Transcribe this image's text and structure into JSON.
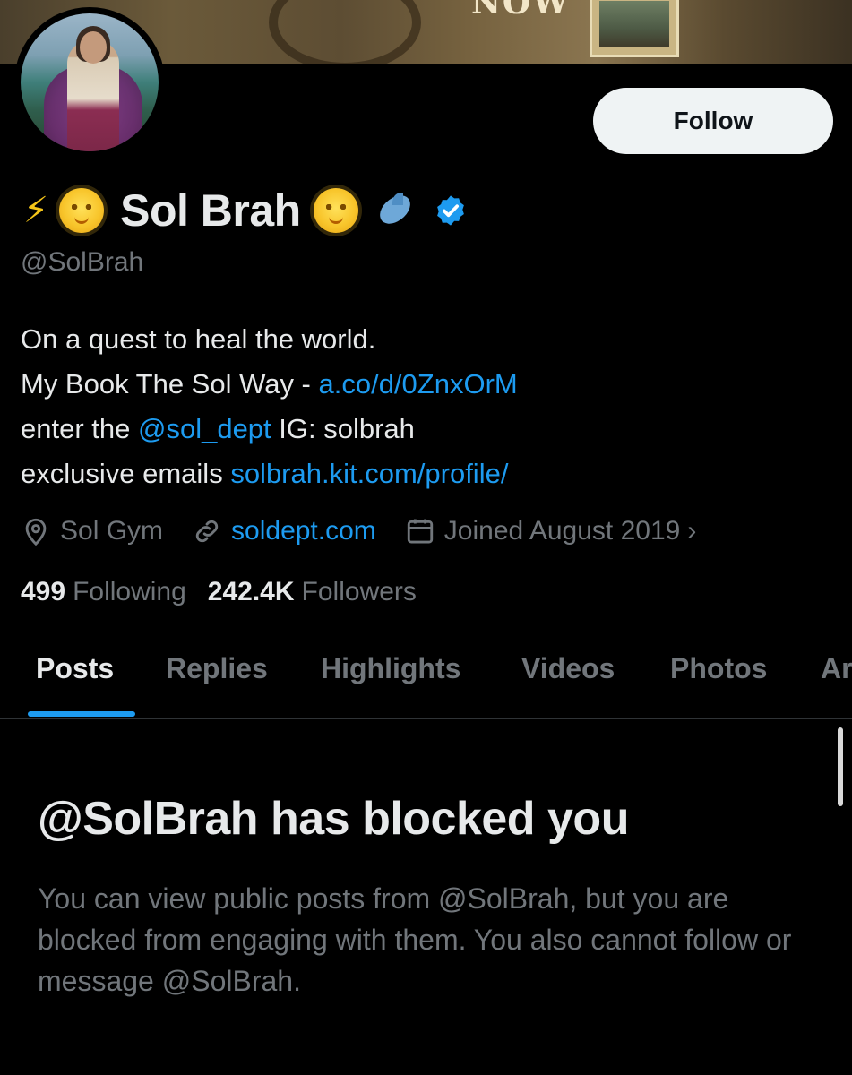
{
  "banner": {
    "text": "NOW"
  },
  "profile": {
    "name": "Sol Brah",
    "handle": "@SolBrah",
    "follow_label": "Follow"
  },
  "bio": {
    "line1": "On a quest to heal the world.",
    "line2_prefix": "My Book The Sol Way - ",
    "line2_link": "a.co/d/0ZnxOrM",
    "line3_prefix": "enter the ",
    "line3_mention": "@sol_dept",
    "line3_suffix": " IG: solbrah",
    "line4_prefix": "exclusive emails ",
    "line4_link": "solbrah.kit.com/profile/"
  },
  "meta": {
    "location": "Sol Gym",
    "website": "soldept.com",
    "joined": "Joined August 2019",
    "location_icon": "location-pin-icon",
    "link_icon": "link-icon",
    "calendar_icon": "calendar-icon",
    "chevron_icon": "chevron-right-icon"
  },
  "stats": {
    "following_count": "499",
    "following_label": "Following",
    "followers_count": "242.4K",
    "followers_label": "Followers"
  },
  "tabs": [
    {
      "label": "Posts",
      "active": true
    },
    {
      "label": "Replies",
      "active": false
    },
    {
      "label": "Highlights",
      "active": false
    },
    {
      "label": "Videos",
      "active": false
    },
    {
      "label": "Photos",
      "active": false
    },
    {
      "label": "Ar",
      "active": false
    }
  ],
  "blocked": {
    "title": "@SolBrah has blocked you",
    "description": "You can view public posts from @SolBrah, but you are blocked from engaging with them. You also cannot follow or message @SolBrah."
  },
  "colors": {
    "background": "#000000",
    "text_primary": "#e7e9ea",
    "text_secondary": "#71767b",
    "accent": "#1d9bf0",
    "follow_button_bg": "#eff3f4"
  }
}
